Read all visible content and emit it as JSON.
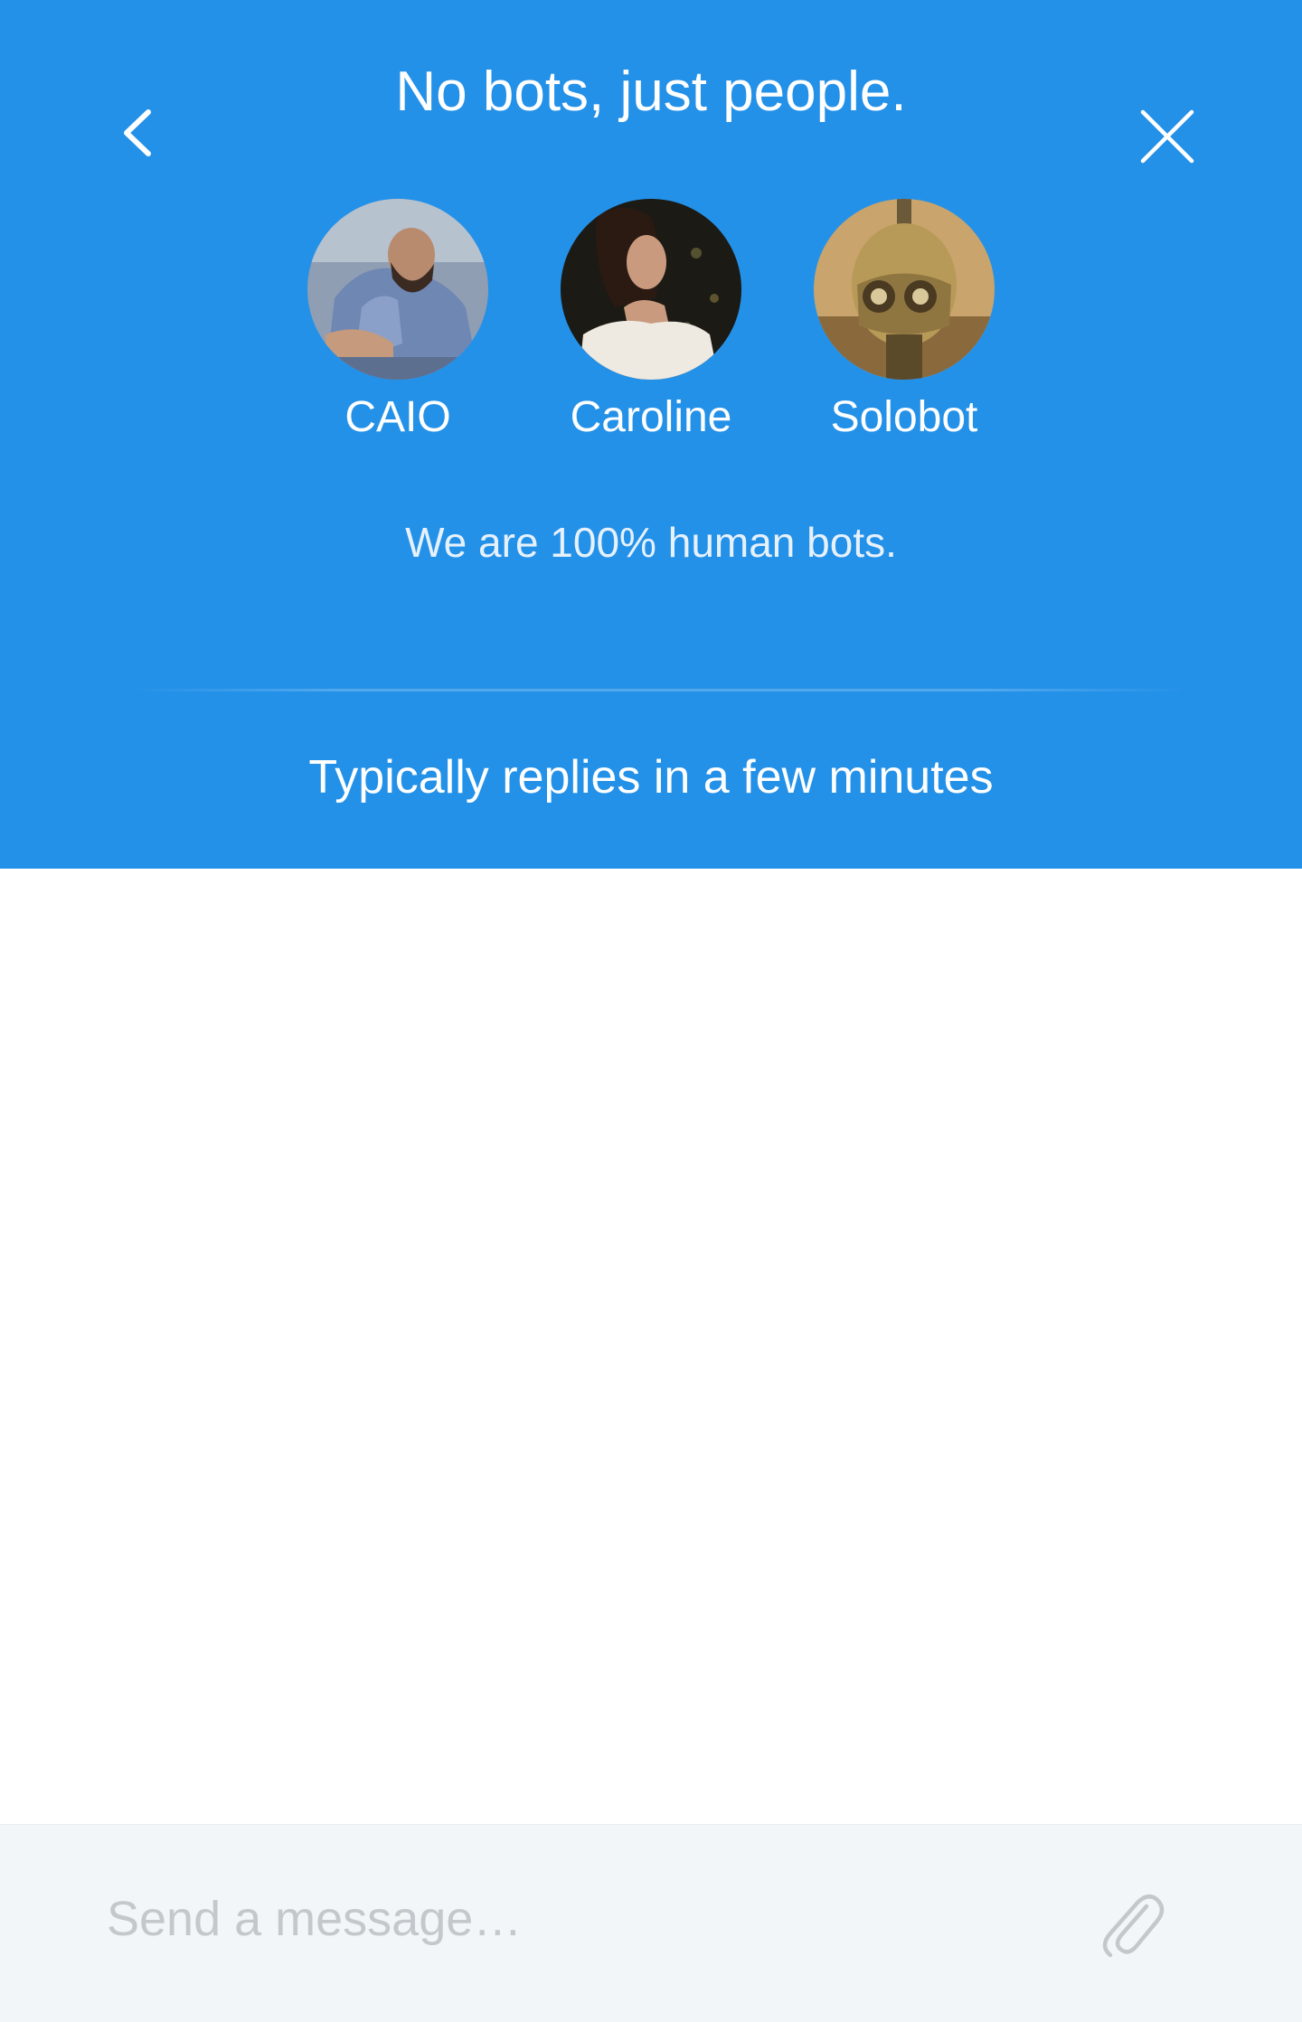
{
  "header": {
    "title": "No bots, just people.",
    "tagline": "We are 100% human bots.",
    "reply_time": "Typically replies in a few minutes",
    "background_color": "#2491e8",
    "back_icon": "chevron-left-icon",
    "close_icon": "close-icon"
  },
  "team": [
    {
      "name": "CAIO"
    },
    {
      "name": "Caroline"
    },
    {
      "name": "Solobot"
    }
  ],
  "composer": {
    "placeholder": "Send a message…",
    "value": "",
    "attach_icon": "paperclip-icon",
    "background_color": "#f2f6f9"
  }
}
